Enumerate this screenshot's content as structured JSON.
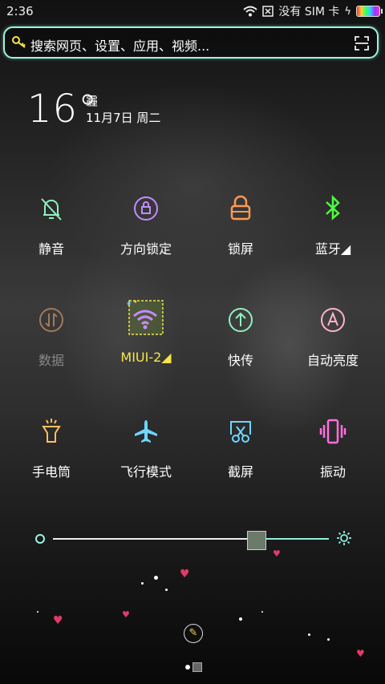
{
  "status": {
    "time": "2:36",
    "carrier": "没有 SIM 卡"
  },
  "search": {
    "placeholder": "搜索网页、设置、应用、视频..."
  },
  "weather": {
    "temperature": "16°",
    "condition": "霾",
    "date": "11月7日 周二"
  },
  "tiles": {
    "mute": "静音",
    "rotation_lock": "方向锁定",
    "lock_screen": "锁屏",
    "bluetooth": "蓝牙◢",
    "data": "数据",
    "wifi": "MIUI-2◢",
    "quick_transfer": "快传",
    "auto_brightness": "自动亮度",
    "flashlight": "手电筒",
    "airplane": "飞行模式",
    "screenshot": "截屏",
    "vibrate": "振动"
  },
  "colors": {
    "mint": "#8ff0c0",
    "purple": "#c48bff",
    "orange": "#ff9a52",
    "green": "#4cff3c",
    "yellow": "#f5e64a",
    "pink": "#ff6fb5",
    "cyan": "#6fd6ff"
  },
  "brightness": {
    "level": 0.72
  }
}
